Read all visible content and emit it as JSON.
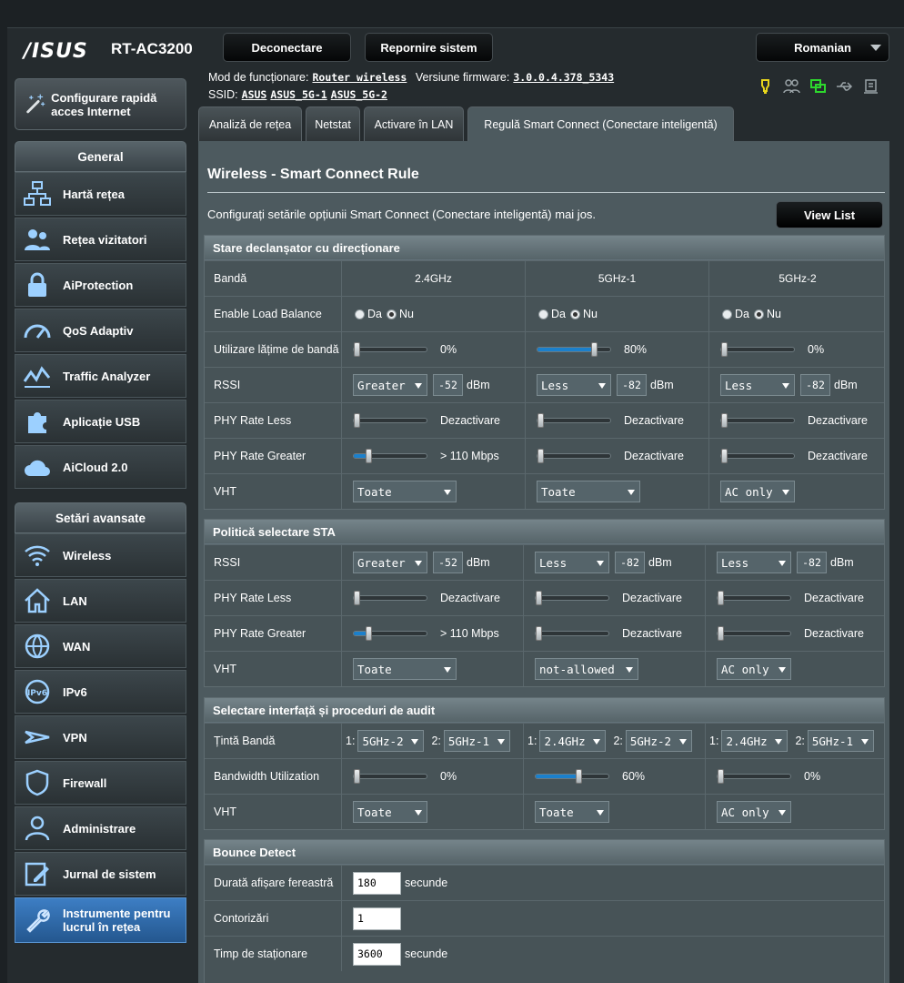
{
  "brand": {
    "logo": "/ISUS",
    "model": "RT-AC3200"
  },
  "header": {
    "disconnect_label": "Deconectare",
    "reboot_label": "Repornire sistem",
    "language": "Romanian"
  },
  "info": {
    "mode_label": "Mod de funcționare:",
    "mode_value": "Router wireless",
    "fw_label": "Versiune firmware:",
    "fw_value": "3.0.0.4.378_5343",
    "ssid_label": "SSID:",
    "ssids": [
      "ASUS",
      "ASUS_5G-1",
      "ASUS_5G-2"
    ]
  },
  "status_icons": [
    "light-bulb-icon",
    "clients-icon",
    "network-icon",
    "usb-icon",
    "printer-icon"
  ],
  "sidebar": {
    "quick_label": "Configurare rapidă acces Internet",
    "general_title": "General",
    "general": [
      "Hartă rețea",
      "Rețea vizitatori",
      "AiProtection",
      "QoS Adaptiv",
      "Traffic Analyzer",
      "Aplicație USB",
      "AiCloud 2.0"
    ],
    "advanced_title": "Setări avansate",
    "advanced": [
      "Wireless",
      "LAN",
      "WAN",
      "IPv6",
      "VPN",
      "Firewall",
      "Administrare",
      "Jurnal de sistem",
      "Instrumente pentru lucrul în rețea"
    ]
  },
  "tabs": [
    "Analiză de rețea",
    "Netstat",
    "Activare în LAN",
    "Regulă Smart Connect (Conectare inteligentă)"
  ],
  "page": {
    "title": "Wireless - Smart Connect Rule",
    "intro": "Configurați setările opțiunii Smart Connect (Conectare inteligentă) mai jos.",
    "view_list": "View List"
  },
  "common": {
    "da": "Da",
    "nu": "Nu",
    "dbm": "dBm",
    "secunde": "secunde",
    "p1": "1:",
    "p2": "2:"
  },
  "s1": {
    "title": "Stare declanșator cu direcționare",
    "labels": [
      "Bandă",
      "Enable Load Balance",
      "Utilizare lățime de bandă",
      "RSSI",
      "PHY Rate Less",
      "PHY Rate Greater",
      "VHT"
    ],
    "bands": [
      "2.4GHz",
      "5GHz-1",
      "5GHz-2"
    ],
    "load_balance": [
      "Nu",
      "Nu",
      "Nu"
    ],
    "bw": [
      {
        "val": "0%",
        "pct": 0
      },
      {
        "val": "80%",
        "pct": 80
      },
      {
        "val": "0%",
        "pct": 0
      }
    ],
    "rssi": [
      {
        "cmp": "Greater",
        "v": "-52"
      },
      {
        "cmp": "Less",
        "v": "-82"
      },
      {
        "cmp": "Less",
        "v": "-82"
      }
    ],
    "phy_less": [
      {
        "val": "Dezactivare",
        "pct": 0
      },
      {
        "val": "Dezactivare",
        "pct": 0
      },
      {
        "val": "Dezactivare",
        "pct": 0
      }
    ],
    "phy_greater": [
      {
        "val": "> 110 Mbps",
        "pct": 18
      },
      {
        "val": "Dezactivare",
        "pct": 0
      },
      {
        "val": "Dezactivare",
        "pct": 0
      }
    ],
    "vht": [
      "Toate",
      "Toate",
      "AC only"
    ]
  },
  "s2": {
    "title": "Politică selectare STA",
    "labels": [
      "RSSI",
      "PHY Rate Less",
      "PHY Rate Greater",
      "VHT"
    ],
    "rssi": [
      {
        "cmp": "Greater",
        "v": "-52"
      },
      {
        "cmp": "Less",
        "v": "-82"
      },
      {
        "cmp": "Less",
        "v": "-82"
      }
    ],
    "phy_less": [
      {
        "val": "Dezactivare",
        "pct": 0
      },
      {
        "val": "Dezactivare",
        "pct": 0
      },
      {
        "val": "Dezactivare",
        "pct": 0
      }
    ],
    "phy_greater": [
      {
        "val": "> 110 Mbps",
        "pct": 18
      },
      {
        "val": "Dezactivare",
        "pct": 0
      },
      {
        "val": "Dezactivare",
        "pct": 0
      }
    ],
    "vht": [
      "Toate",
      "not-allowed",
      "AC only"
    ]
  },
  "s3": {
    "title": "Selectare interfață și proceduri de audit",
    "labels": [
      "Țintă Bandă",
      "Bandwidth Utilization",
      "VHT"
    ],
    "target": [
      [
        "5GHz-2",
        "5GHz-1"
      ],
      [
        "2.4GHz",
        "5GHz-2"
      ],
      [
        "2.4GHz",
        "5GHz-1"
      ]
    ],
    "bw": [
      {
        "val": "0%",
        "pct": 0
      },
      {
        "val": "60%",
        "pct": 60
      },
      {
        "val": "0%",
        "pct": 0
      }
    ],
    "vht": [
      "Toate",
      "Toate",
      "AC only"
    ]
  },
  "s4": {
    "title": "Bounce Detect",
    "labels": [
      "Durată afișare fereastră",
      "Contorizări",
      "Timp de staționare"
    ],
    "values": [
      "180",
      "1",
      "3600"
    ]
  }
}
